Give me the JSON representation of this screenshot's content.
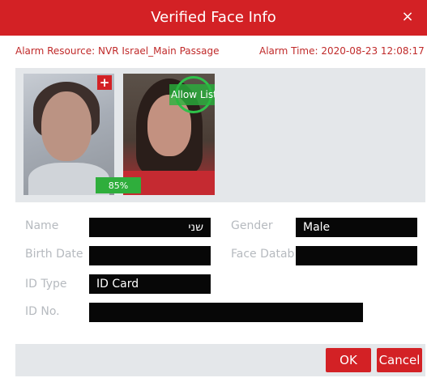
{
  "dialog": {
    "title": "Verified Face Info",
    "close_symbol": "×"
  },
  "alarm": {
    "resource": "Alarm Resource: NVR Israel_Main Passage",
    "time": "Alarm Time: 2020-08-23 12:08:17"
  },
  "snapshot": {
    "add_symbol": "+",
    "similarity": "85%"
  },
  "match": {
    "badge": "Allow List"
  },
  "form": {
    "name_label": "Name",
    "name_value": "שני",
    "gender_label": "Gender",
    "gender_value": "Male",
    "birth_label": "Birth Date",
    "birth_value": "",
    "face_db_label": "Face Datab",
    "face_db_value": "",
    "id_type_label": "ID Type",
    "id_type_value": "ID Card",
    "id_no_label": "ID No.",
    "id_no_value": ""
  },
  "buttons": {
    "ok": "OK",
    "cancel": "Cancel"
  },
  "colors": {
    "accent": "#d32125",
    "match_green": "#2fae3c",
    "panel_bg": "#e4e7ea"
  }
}
